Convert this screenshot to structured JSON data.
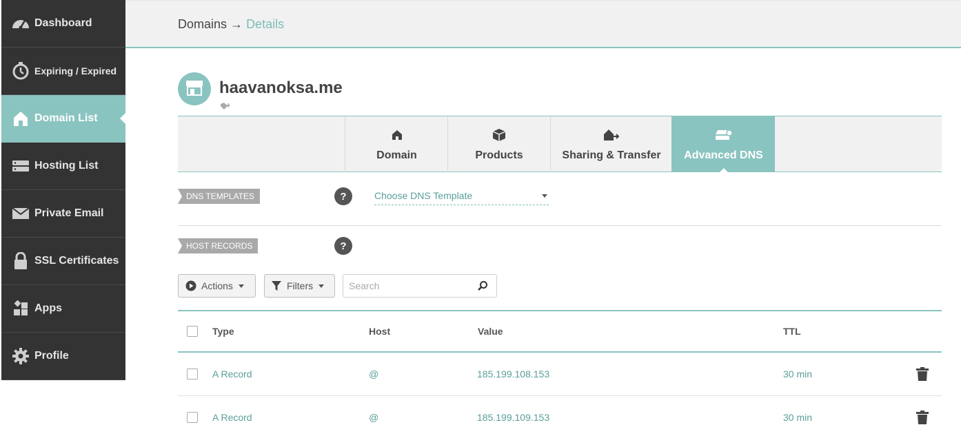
{
  "sidebar": {
    "items": [
      {
        "label": "Dashboard",
        "icon": "speedometer-icon"
      },
      {
        "label": "Expiring / Expired",
        "icon": "timer-icon"
      },
      {
        "label": "Domain List",
        "icon": "home-icon",
        "active": true
      },
      {
        "label": "Hosting List",
        "icon": "server-icon"
      },
      {
        "label": "Private Email",
        "icon": "envelope-icon"
      },
      {
        "label": "SSL Certificates",
        "icon": "lock-icon"
      },
      {
        "label": "Apps",
        "icon": "apps-icon"
      },
      {
        "label": "Profile",
        "icon": "gear-icon"
      }
    ]
  },
  "breadcrumb": {
    "parent": "Domains",
    "separator": "→",
    "current": "Details"
  },
  "domain": {
    "name": "haavanoksa.me"
  },
  "tabs": [
    {
      "label": "Domain",
      "icon": "home-icon"
    },
    {
      "label": "Products",
      "icon": "box-icon"
    },
    {
      "label": "Sharing & Transfer",
      "icon": "transfer-icon"
    },
    {
      "label": "Advanced DNS",
      "icon": "dns-icon",
      "active": true
    }
  ],
  "dns_templates": {
    "label": "DNS TEMPLATES",
    "help": "?",
    "select_value": "Choose DNS Template"
  },
  "host_records": {
    "label": "HOST RECORDS",
    "help": "?"
  },
  "toolbar": {
    "actions_label": "Actions",
    "filters_label": "Filters",
    "search_placeholder": "Search"
  },
  "table": {
    "columns": {
      "type": "Type",
      "host": "Host",
      "value": "Value",
      "ttl": "TTL"
    },
    "rows": [
      {
        "type": "A Record",
        "host": "@",
        "value": "185.199.108.153",
        "ttl": "30 min"
      },
      {
        "type": "A Record",
        "host": "@",
        "value": "185.199.109.153",
        "ttl": "30 min"
      }
    ]
  },
  "colors": {
    "accent": "#8ac4c0",
    "sidebar_bg": "#333333",
    "link": "#5a9e99"
  }
}
